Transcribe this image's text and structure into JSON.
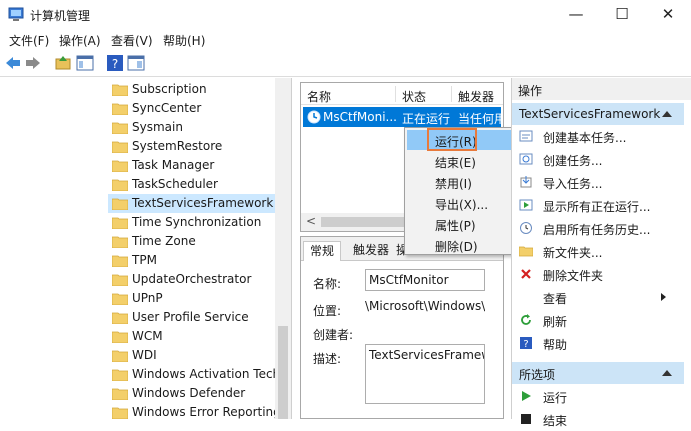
{
  "window": {
    "title": "计算机管理",
    "minimize": "—",
    "maximize": "☐",
    "close": "✕"
  },
  "menu": [
    "文件(F)",
    "操作(A)",
    "查看(V)",
    "帮助(H)"
  ],
  "tree": {
    "items": [
      "Subscription",
      "SyncCenter",
      "Sysmain",
      "SystemRestore",
      "Task Manager",
      "TaskScheduler",
      "TextServicesFramework",
      "Time Synchronization",
      "Time Zone",
      "TPM",
      "UpdateOrchestrator",
      "UPnP",
      "User Profile Service",
      "WCM",
      "WDI",
      "Windows Activation Techn",
      "Windows Defender",
      "Windows Error Reporting"
    ],
    "selected_index": 6
  },
  "list": {
    "columns": [
      "名称",
      "状态",
      "触发器"
    ],
    "row": {
      "name": "MsCtfMoni...",
      "status": "正在运行",
      "trigger": "当任何用"
    },
    "scroll_left": "<"
  },
  "context_menu": {
    "items": [
      "运行(R)",
      "结束(E)",
      "禁用(I)",
      "导出(X)...",
      "属性(P)",
      "删除(D)"
    ],
    "highlighted_index": 0
  },
  "details": {
    "tabs": [
      "常规",
      "触发器",
      "操"
    ],
    "fields": {
      "name_label": "名称:",
      "name_value": "MsCtfMonitor",
      "location_label": "位置:",
      "location_value": "\\Microsoft\\Windows\\",
      "author_label": "创建者:",
      "desc_label": "描述:",
      "desc_value": "TextServicesFramew"
    }
  },
  "actions": {
    "header": "操作",
    "section": "TextServicesFramework",
    "items": [
      {
        "label": "创建基本任务...",
        "icon": "basic-task-icon"
      },
      {
        "label": "创建任务...",
        "icon": "task-icon"
      },
      {
        "label": "导入任务...",
        "icon": "import-icon"
      },
      {
        "label": "显示所有正在运行...",
        "icon": "running-icon"
      },
      {
        "label": "启用所有任务历史...",
        "icon": "history-icon"
      },
      {
        "label": "新文件夹...",
        "icon": "new-folder-icon"
      },
      {
        "label": "删除文件夹",
        "icon": "delete-icon"
      },
      {
        "label": "查看",
        "icon": "none"
      },
      {
        "label": "刷新",
        "icon": "refresh-icon"
      },
      {
        "label": "帮助",
        "icon": "help-icon"
      }
    ],
    "selected_header": "所选项",
    "selected_items": [
      {
        "label": "运行",
        "icon": "run-icon"
      },
      {
        "label": "结束",
        "icon": "stop-icon"
      }
    ]
  },
  "colors": {
    "selection": "#0078d7",
    "highlight": "#cce8ff",
    "outline": "#e87a3c"
  }
}
